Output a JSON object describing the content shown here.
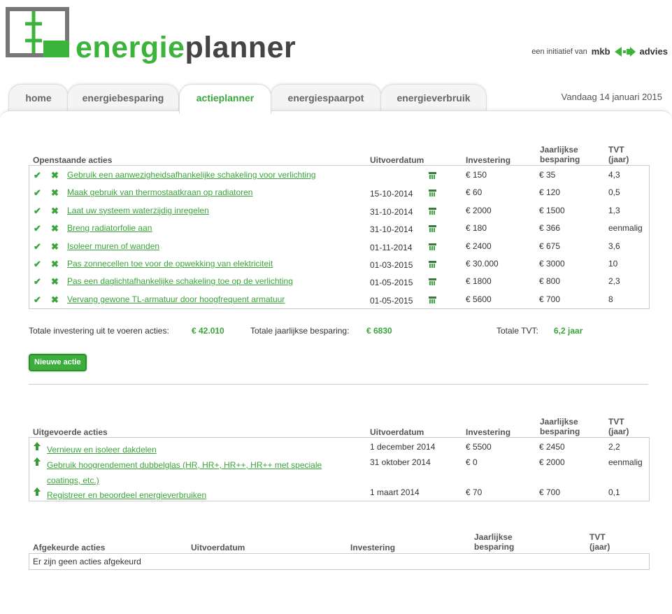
{
  "header": {
    "brand_prefix": "energie",
    "brand_suffix": "planner",
    "initiative_text": "een initiatief van",
    "partner_left": "mkb",
    "partner_right": "advies"
  },
  "tabs": [
    {
      "label": "home"
    },
    {
      "label": "energiebesparing"
    },
    {
      "label": "actieplanner"
    },
    {
      "label": "energiespaarpot"
    },
    {
      "label": "energieverbruik"
    }
  ],
  "active_tab": "actieplanner",
  "today": "Vandaag 14 januari 2015",
  "columns": {
    "uitvoerdatum": "Uitvoerdatum",
    "investering": "Investering",
    "besparing_1": "Jaarlijkse",
    "besparing_2": "besparing",
    "tvt_1": "TVT",
    "tvt_2": "(jaar)"
  },
  "open": {
    "title": "Openstaande acties",
    "rows": [
      {
        "action": "Gebruik een aanwezigheidsafhankelijke schakeling voor verlichting",
        "date": "",
        "inv": "€ 150",
        "bes": "€ 35",
        "tvt": "4,3"
      },
      {
        "action": "Maak gebruik van thermostaatkraan op radiatoren",
        "date": "15-10-2014",
        "inv": "€ 60",
        "bes": "€ 120",
        "tvt": "0,5"
      },
      {
        "action": "Laat uw systeem waterzijdig inregelen",
        "date": "31-10-2014",
        "inv": "€ 2000",
        "bes": "€ 1500",
        "tvt": "1,3"
      },
      {
        "action": "Breng radiatorfolie aan",
        "date": "31-10-2014",
        "inv": "€ 180",
        "bes": "€ 366",
        "tvt": "eenmalig"
      },
      {
        "action": "Isoleer muren of wanden",
        "date": "01-11-2014",
        "inv": "€ 2400",
        "bes": "€ 675",
        "tvt": "3,6"
      },
      {
        "action": "Pas zonnecellen toe voor de opwekking van elektriciteit",
        "date": "01-03-2015",
        "inv": "€ 30.000",
        "bes": "€ 3000",
        "tvt": "10"
      },
      {
        "action": "Pas een daglichtafhankelijke schakeling toe op de verlichting",
        "date": "01-05-2015",
        "inv": "€ 1800",
        "bes": "€ 800",
        "tvt": "2,3"
      },
      {
        "action": "Vervang gewone TL-armatuur door hoogfrequent armatuur",
        "date": "01-05-2015",
        "inv": "€ 5600",
        "bes": "€ 700",
        "tvt": "8"
      }
    ]
  },
  "totals": {
    "inv_label": "Totale investering uit te voeren acties:",
    "inv_value": "€ 42.010",
    "bes_label": "Totale jaarlijkse besparing:",
    "bes_value": "€ 6830",
    "tvt_label": "Totale TVT:",
    "tvt_value": "6,2 jaar"
  },
  "new_action_button": "Nieuwe actie",
  "done": {
    "title": "Uitgevoerde acties",
    "rows": [
      {
        "action": "Vernieuw en isoleer dakdelen",
        "action2": "",
        "date": "1 december 2014",
        "inv": "€ 5500",
        "bes": "€ 2450",
        "tvt": "2,2"
      },
      {
        "action": "Gebruik hoogrendement dubbelglas (HR, HR+, HR++, HR++ met speciale",
        "action2": "coatings, etc.)",
        "date": "31 oktober 2014",
        "inv": "€ 0",
        "bes": "€ 2000",
        "tvt": "eenmalig"
      },
      {
        "action": "Registreer en beoordeel energieverbruiken",
        "action2": "",
        "date": "1 maart 2014",
        "inv": "€ 70",
        "bes": "€ 700",
        "tvt": "0,1"
      }
    ]
  },
  "rejected": {
    "title": "Afgekeurde acties",
    "empty": "Er zijn geen acties afgekeurd"
  },
  "icons": {
    "accept": "check-icon",
    "reject": "cross-icon",
    "calendar": "calendar-icon",
    "done": "arrow-up-icon"
  },
  "colors": {
    "brand_green": "#3cb43c",
    "link_green": "#3aa53a"
  }
}
